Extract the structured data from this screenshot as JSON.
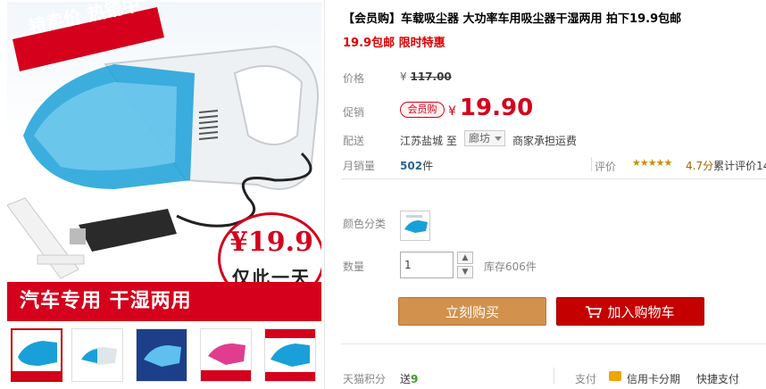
{
  "product": {
    "title": "【会员购】车载吸尘器 大功率车用吸尘器干湿两用 拍下19.9包邮",
    "subtitle": "19.9包邮 限时特惠"
  },
  "gallery": {
    "hot_tag": "特卖价 热销中",
    "price_badge": "¥19.9",
    "price_badge_sub": "仅此一天",
    "banner": "汽车专用 干湿两用",
    "thumbnails": [
      "thumb-1",
      "thumb-2",
      "thumb-3",
      "thumb-4",
      "thumb-5"
    ]
  },
  "price": {
    "label": "价格",
    "currency": "¥",
    "original": "117.00"
  },
  "promo": {
    "label": "促销",
    "badge": "会员购",
    "currency": "¥",
    "price": "19.90"
  },
  "shipping": {
    "label": "配送",
    "from": "江苏盐城 至",
    "to": "廊坊",
    "fee": "商家承担运费"
  },
  "sales": {
    "label": "月销量",
    "count": "502",
    "unit": "件"
  },
  "rating": {
    "label": "评价",
    "stars": "★★★★★",
    "score": "4.7分",
    "count_text": "累计评价14"
  },
  "color": {
    "label": "颜色分类"
  },
  "quantity": {
    "label": "数量",
    "value": "1",
    "up": "▲",
    "down": "▼",
    "stock": "库存606件"
  },
  "actions": {
    "buy": "立刻购买",
    "cart": "加入购物车"
  },
  "footer": {
    "points_label": "天猫积分",
    "points_prefix": "送",
    "points_value": "9",
    "pay_label": "支付",
    "card_pay": "信用卡分期",
    "quick_pay": "快捷支付"
  },
  "colors": {
    "accent": "#c40000",
    "buy": "#d2914c"
  }
}
